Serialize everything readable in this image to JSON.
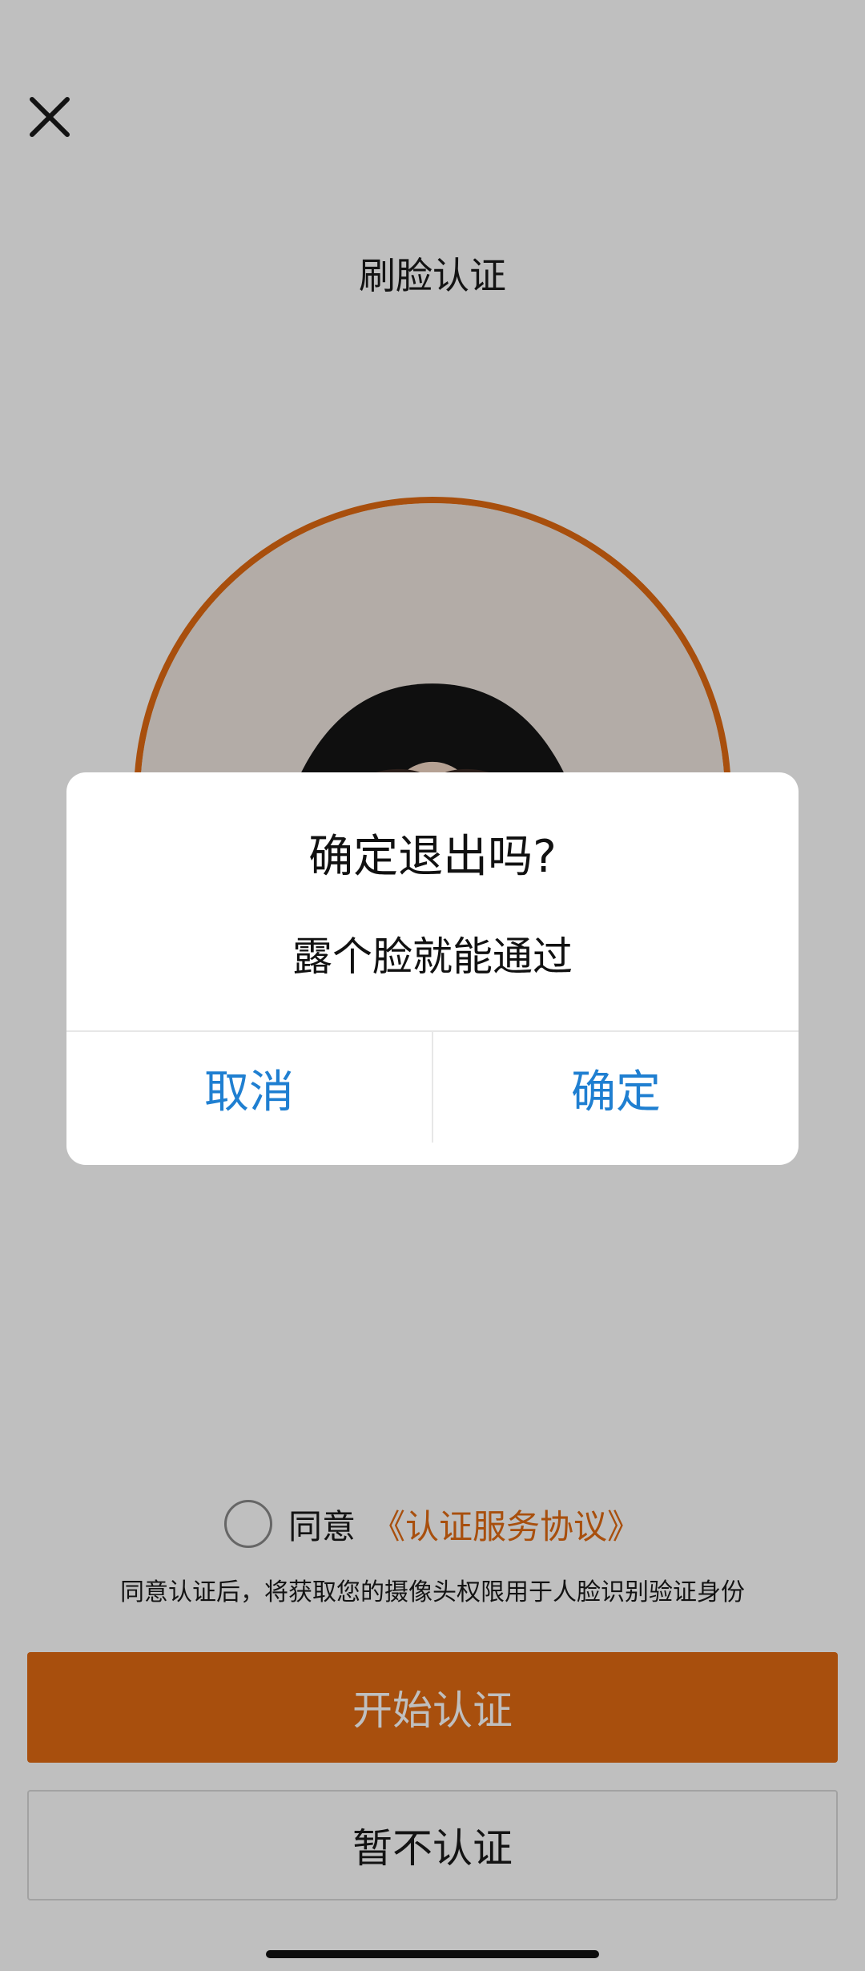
{
  "page": {
    "title": "刷脸认证",
    "agree_prefix": "同意",
    "agree_link": "《认证服务协议》",
    "notice": "同意认证后，将获取您的摄像头权限用于人脸识别验证身份",
    "start_button": "开始认证",
    "skip_button": "暂不认证"
  },
  "dialog": {
    "title": "确定退出吗?",
    "message": "露个脸就能通过",
    "cancel": "取消",
    "confirm": "确定"
  },
  "colors": {
    "accent": "#e16a12",
    "link_blue": "#1f7fd1"
  },
  "icons": {
    "close": "close-icon",
    "check": "checkbox-circle"
  }
}
